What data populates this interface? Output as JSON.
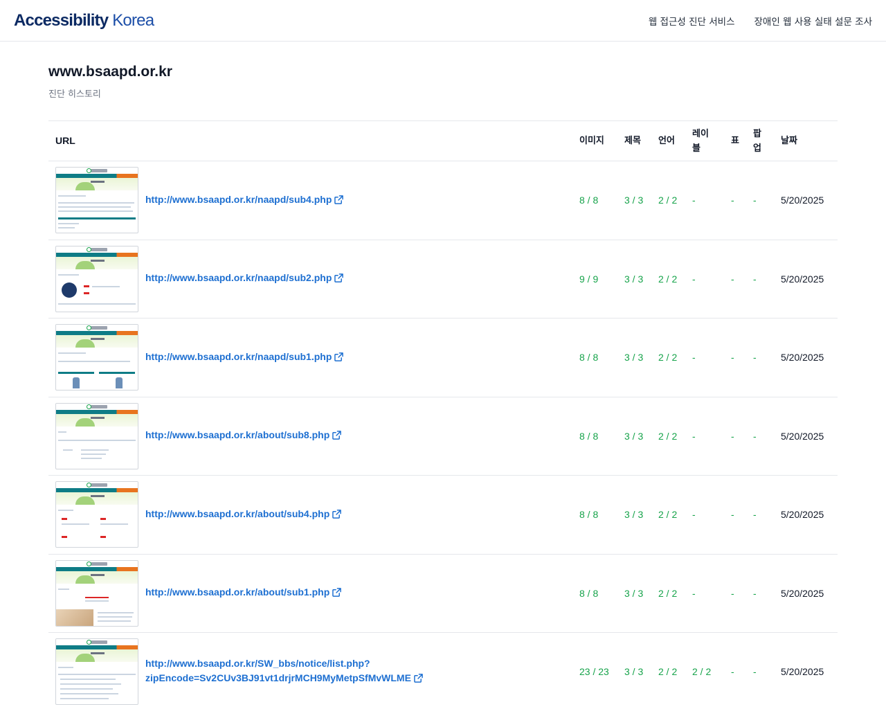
{
  "header": {
    "logo_bold": "Accessibility",
    "logo_regular": "Korea",
    "nav": [
      "웹 접근성 진단 서비스",
      "장애인 웹 사용 실태 설문 조사"
    ]
  },
  "page": {
    "title": "www.bsaapd.or.kr",
    "subtitle": "진단 히스토리"
  },
  "table": {
    "headers": {
      "url": "URL",
      "image": "이미지",
      "title": "제목",
      "language": "언어",
      "label_line1": "레이",
      "label_line2": "블",
      "table": "표",
      "popup_line1": "팝",
      "popup_line2": "업",
      "date": "날짜"
    },
    "rows": [
      {
        "url_line1": "http://www.bsaapd.or.kr/naapd/sub4.php",
        "url_line2": "",
        "image": "8 / 8",
        "title": "3 / 3",
        "language": "2 / 2",
        "label": "-",
        "table": "-",
        "popup": "-",
        "date": "5/20/2025"
      },
      {
        "url_line1": "http://www.bsaapd.or.kr/naapd/sub2.php",
        "url_line2": "",
        "image": "9 / 9",
        "title": "3 / 3",
        "language": "2 / 2",
        "label": "-",
        "table": "-",
        "popup": "-",
        "date": "5/20/2025"
      },
      {
        "url_line1": "http://www.bsaapd.or.kr/naapd/sub1.php",
        "url_line2": "",
        "image": "8 / 8",
        "title": "3 / 3",
        "language": "2 / 2",
        "label": "-",
        "table": "-",
        "popup": "-",
        "date": "5/20/2025"
      },
      {
        "url_line1": "http://www.bsaapd.or.kr/about/sub8.php",
        "url_line2": "",
        "image": "8 / 8",
        "title": "3 / 3",
        "language": "2 / 2",
        "label": "-",
        "table": "-",
        "popup": "-",
        "date": "5/20/2025"
      },
      {
        "url_line1": "http://www.bsaapd.or.kr/about/sub4.php",
        "url_line2": "",
        "image": "8 / 8",
        "title": "3 / 3",
        "language": "2 / 2",
        "label": "-",
        "table": "-",
        "popup": "-",
        "date": "5/20/2025"
      },
      {
        "url_line1": "http://www.bsaapd.or.kr/about/sub1.php",
        "url_line2": "",
        "image": "8 / 8",
        "title": "3 / 3",
        "language": "2 / 2",
        "label": "-",
        "table": "-",
        "popup": "-",
        "date": "5/20/2025"
      },
      {
        "url_line1": "http://www.bsaapd.or.kr/SW_bbs/notice/list.php?",
        "url_line2": "zipEncode=Sv2CUv3BJ91vt1drjrMCH9MyMetpSfMvWLME",
        "image": "23 / 23",
        "title": "3 / 3",
        "language": "2 / 2",
        "label": "2 / 2",
        "table": "-",
        "popup": "-",
        "date": "5/20/2025"
      }
    ]
  },
  "colors": {
    "brand": "#0c2a63",
    "link": "#1d6fd1",
    "score_pass": "#16a34a",
    "border": "#e5e7eb"
  },
  "icons": {
    "external": "external-link-icon"
  }
}
